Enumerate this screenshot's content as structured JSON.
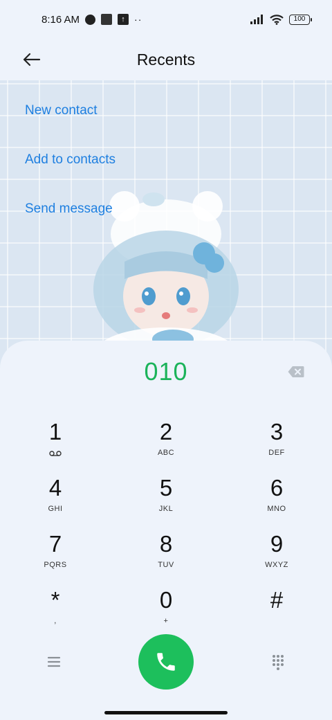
{
  "status_bar": {
    "time": "8:16 AM",
    "notif_icons": [
      "profile-icon",
      "square-app-icon",
      "upload-icon"
    ],
    "more_dots": "··",
    "signal": "signal-icon",
    "wifi": "wifi-icon",
    "battery_level": "100"
  },
  "header": {
    "title": "Recents",
    "back_icon": "arrow-left-icon"
  },
  "actions": [
    {
      "label": "New contact"
    },
    {
      "label": "Add to contacts"
    },
    {
      "label": "Send message"
    }
  ],
  "dialer": {
    "number": "010",
    "keys": [
      {
        "digit": "1",
        "letters": "",
        "sub_icon": "voicemail-icon"
      },
      {
        "digit": "2",
        "letters": "ABC"
      },
      {
        "digit": "3",
        "letters": "DEF"
      },
      {
        "digit": "4",
        "letters": "GHI"
      },
      {
        "digit": "5",
        "letters": "JKL"
      },
      {
        "digit": "6",
        "letters": "MNO"
      },
      {
        "digit": "7",
        "letters": "PQRS"
      },
      {
        "digit": "8",
        "letters": "TUV"
      },
      {
        "digit": "9",
        "letters": "WXYZ"
      },
      {
        "digit": "*",
        "letters": ","
      },
      {
        "digit": "0",
        "letters": "+"
      },
      {
        "digit": "#",
        "letters": ""
      }
    ]
  },
  "colors": {
    "accent_link": "#1e7fe0",
    "number_green": "#1bb35a",
    "call_green": "#1dbf5c",
    "background": "#eef3fb"
  }
}
